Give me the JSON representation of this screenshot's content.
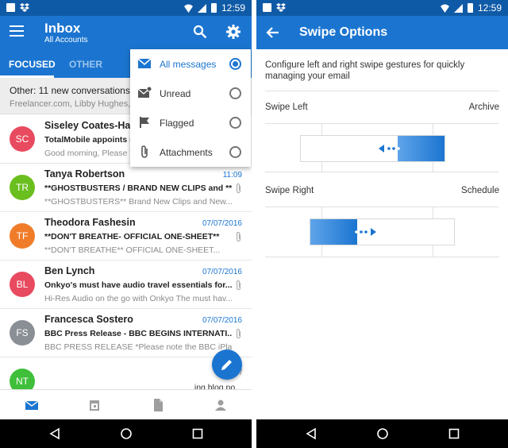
{
  "status_bar": {
    "time": "12:59"
  },
  "inbox_screen": {
    "title": "Inbox",
    "subtitle": "All Accounts",
    "tabs": [
      {
        "label": "FOCUSED",
        "selected": true
      },
      {
        "label": "OTHER",
        "selected": false
      }
    ],
    "other_banner": {
      "title": "Other: 11 new conversations",
      "senders": "Freelancer.com, Libby Hughes, A..."
    },
    "messages": [
      {
        "initials": "SC",
        "avatar_color": "#e84a5f",
        "sender": "Siseley Coates-Hardy",
        "date": "",
        "subject": "TotalMobile appoints ne...",
        "preview": "Good morning, Please fi...",
        "attachment": false
      },
      {
        "initials": "TR",
        "avatar_color": "#6abf1f",
        "sender": "Tanya Robertson",
        "date": "11:09",
        "subject": "**GHOSTBUSTERS / BRAND NEW CLIPS and **",
        "preview": "**GHOSTBUSTERS** Brand New Clips and New...",
        "attachment": true
      },
      {
        "initials": "TF",
        "avatar_color": "#f07c2a",
        "sender": "Theodora Fashesin",
        "date": "07/07/2016",
        "subject": "**DON'T BREATHE- OFFICIAL ONE-SHEET**",
        "preview": "**DON'T BREATHE** OFFICIAL ONE-SHEET...",
        "attachment": true
      },
      {
        "initials": "BL",
        "avatar_color": "#e84a5f",
        "sender": "Ben Lynch",
        "date": "07/07/2016",
        "subject": "Onkyo's must have audio travel essentials for...",
        "preview": "Hi-Res Audio on the go with Onkyo The must hav...",
        "attachment": true
      },
      {
        "initials": "FS",
        "avatar_color": "#8a8f96",
        "sender": "Francesca Sostero",
        "date": "07/07/2016",
        "subject": "BBC Press Release - BBC BEGINS INTERNATI...",
        "preview": "BBC PRESS RELEASE *Please note the BBC iPla...",
        "attachment": true
      },
      {
        "initials": "NT",
        "avatar_color": "#3fbf3a",
        "sender": "",
        "date": "07/",
        "subject": "ing blog po...",
        "preview": "",
        "attachment": false
      }
    ],
    "filter_menu": {
      "items": [
        {
          "label": "All messages",
          "icon": "all-mail-icon",
          "selected": true
        },
        {
          "label": "Unread",
          "icon": "unread-icon",
          "selected": false
        },
        {
          "label": "Flagged",
          "icon": "flag-icon",
          "selected": false
        },
        {
          "label": "Attachments",
          "icon": "paperclip-icon",
          "selected": false
        }
      ]
    },
    "bottom_nav": [
      "mail-icon",
      "calendar-icon",
      "files-icon",
      "people-icon"
    ]
  },
  "swipe_screen": {
    "title": "Swipe Options",
    "description": "Configure left and right swipe gestures for quickly managing your email",
    "swipe_left": {
      "label": "Swipe Left",
      "value": "Archive"
    },
    "swipe_right": {
      "label": "Swipe Right",
      "value": "Schedule"
    }
  },
  "colors": {
    "accent": "#1b75d0",
    "status_bar": "#0f5aa6"
  }
}
